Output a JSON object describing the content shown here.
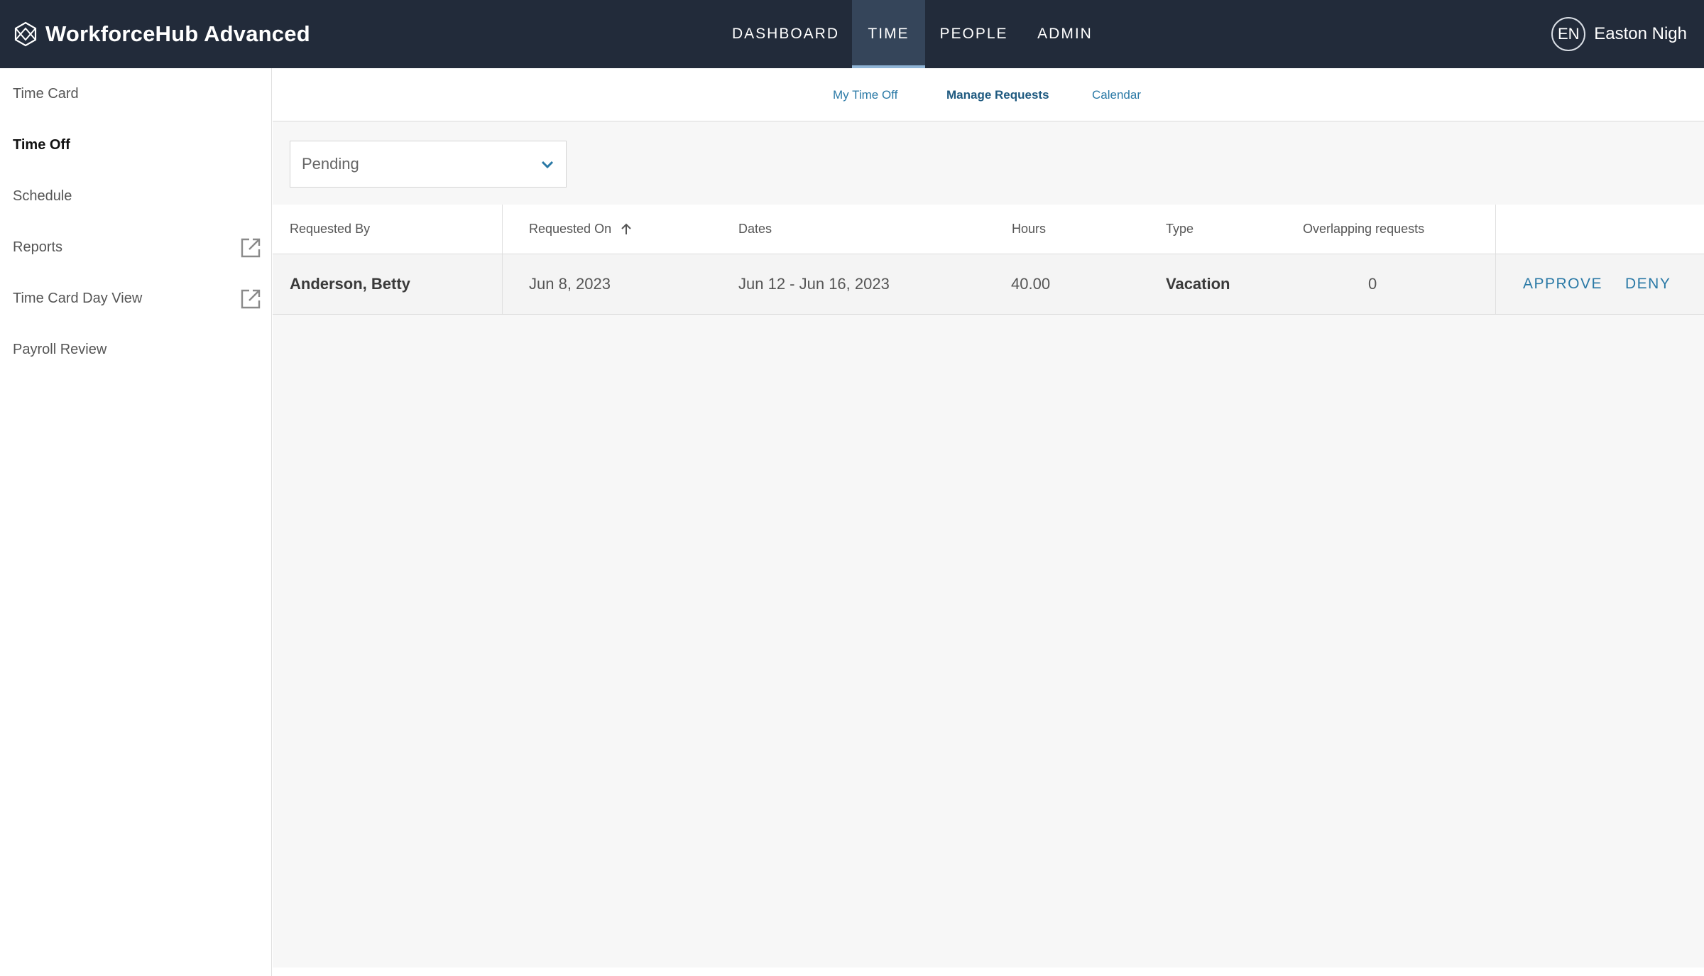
{
  "app": {
    "title": "WorkforceHub Advanced",
    "logo_icon": "workforcehub-logo-icon"
  },
  "mainnav": {
    "items": [
      {
        "label": "DASHBOARD"
      },
      {
        "label": "TIME",
        "active": true
      },
      {
        "label": "PEOPLE"
      },
      {
        "label": "ADMIN"
      }
    ]
  },
  "user": {
    "initials": "EN",
    "name": "Easton Nigh"
  },
  "sidebar": {
    "items": [
      {
        "label": "Time Card"
      },
      {
        "label": "Time Off",
        "active": true
      },
      {
        "label": "Schedule"
      },
      {
        "label": "Reports",
        "icon": "external-link-icon"
      },
      {
        "label": "Time Card Day View",
        "icon": "external-link-icon"
      },
      {
        "label": "Payroll Review"
      }
    ]
  },
  "subnav": {
    "tabs": [
      {
        "label": "My Time Off"
      },
      {
        "label": "Manage Requests",
        "active": true
      },
      {
        "label": "Calendar"
      }
    ]
  },
  "filter": {
    "selected": "Pending",
    "icon": "chevron-down-icon"
  },
  "table": {
    "headers": {
      "requested_by": "Requested By",
      "requested_on": "Requested On",
      "dates": "Dates",
      "hours": "Hours",
      "type": "Type",
      "overlapping": "Overlapping requests"
    },
    "sort_icon": "arrow-up-icon",
    "rows": [
      {
        "requested_by": "Anderson, Betty",
        "requested_on": "Jun 8, 2023",
        "dates": "Jun 12 - Jun 16, 2023",
        "hours": "40.00",
        "type": "Vacation",
        "overlapping": "0",
        "approve_label": "APPROVE",
        "deny_label": "DENY"
      }
    ]
  },
  "colors": {
    "topbar": "#222b3a",
    "active_nav": "#35455a",
    "accent": "#2a79a6",
    "content_bg": "#f7f7f7"
  }
}
